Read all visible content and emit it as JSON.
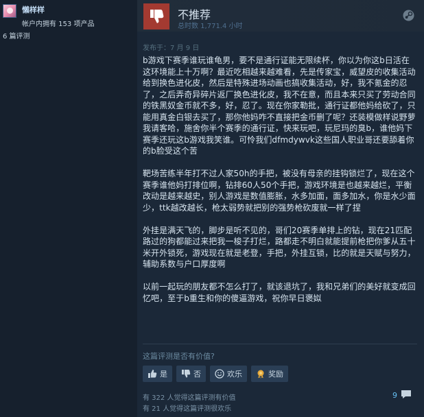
{
  "author": {
    "name": "懶样样",
    "products_owned": "帐户内拥有 153 项产品",
    "review_count": "6 篇评测"
  },
  "review": {
    "verdict": "不推荐",
    "hours": "总时数 1,771.4 小时",
    "posted": "发布于：7 月 9 日",
    "paragraphs": [
      "b游戏下赛季谁玩谁龟男，要不是通行证能无限续杯，你以为你这b日活在这环境能上十万啊？最近吃相越来越难看，先是传家宝，威望皮的收集活动给到换色进化皮，然后是特殊进场动画也搞收集活动，好，我不氪金的忍了，之后弄奇异碎片返厂换色进化皮，我不在意，而且本来只买了劳动合同的铁黑奴金币就不多，好，忍了。现在你家勒批，通行证都他妈给砍了，只能用真金白银去买了，那你他妈咋不直接把金币删了呢？还装模做样说野萝我请客哈，施舍你半个赛季的通行证，快来玩吧，玩尼玛的臭b，谁他妈下赛季还玩这b游戏我笑谁。可怜我们dfmdywvk这些国人职业哥还要舔着你的b脸受这个苦",
      "靶场苦练半年打不过人家50h的手把，被没有母亲的挂钩锁烂了，现在这个赛季谁他妈打排位啊，钻排60人50个手把，游戏环境是也越来越烂，平衡改动是越来越史，别人游戏是数值膨胀，水多加面，面多加水，你是水少面少，ttk越改越长，枪太弱势就把别的强势枪砍废就一样了捏",
      "外挂是满天飞的，脚步是听不见的，哥们20赛季单排上的钻，现在21匹配路过的狗都能过来把我一梭子打烂，路都走不明白就能提前枪把你爹从五十米开外锁死，游戏现在就是老登，手把，外挂互锁，比的就是天赋与努力，辅助系数与户口厚度啊",
      "以前一起玩的朋友都不怎么打了，就该退坑了，我和兄弟们的美好就变成回忆吧，至于b重生和你的傻逼游戏，祝你早日褒姒"
    ]
  },
  "helpful": {
    "question": "这篇评测是否有价值?",
    "yes_label": "是",
    "no_label": "否",
    "funny_label": "欢乐",
    "award_label": "奖励",
    "helpful_stat": "有 322 人觉得这篇评测有价值",
    "funny_stat": "有 21 人觉得这篇评测很欢乐",
    "comment_count": "9"
  },
  "colors": {
    "background": "#1b2838",
    "thumb_down": "#a33a31",
    "link_blue": "#66c0f4"
  }
}
